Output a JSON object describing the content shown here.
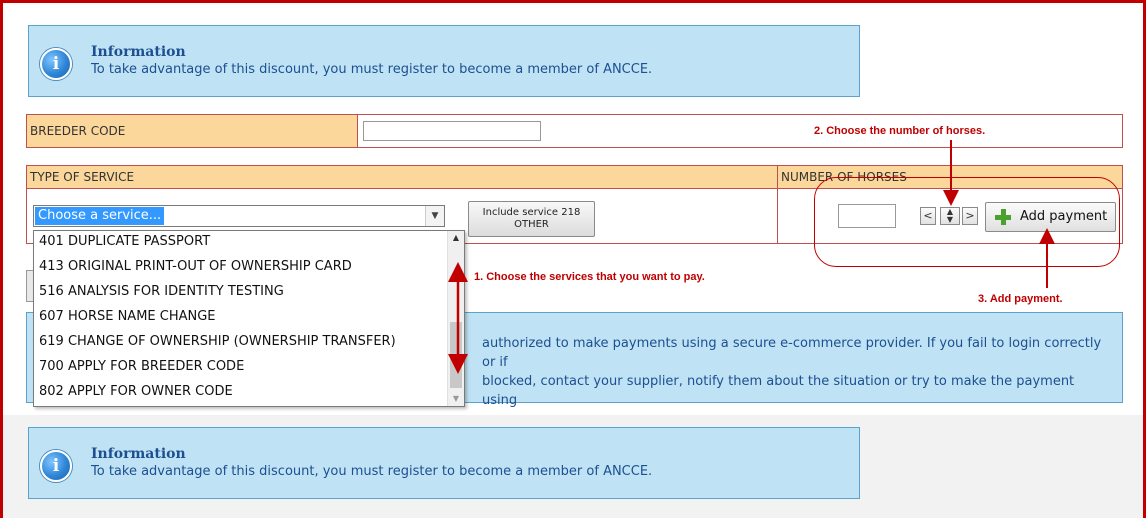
{
  "info_top": {
    "title": "Information",
    "text": "To take advantage of this discount, you must register to become a member of ANCCE."
  },
  "breeder": {
    "label": "BREEDER CODE",
    "value": ""
  },
  "service_table": {
    "type_header": "TYPE OF SERVICE",
    "number_header": "NUMBER OF HORSES",
    "select_value": "Choose a service...",
    "include_button": {
      "line1": "Include service 218",
      "line2": "OTHER"
    },
    "add_button": "Add payment"
  },
  "dropdown_options": [
    "401 DUPLICATE PASSPORT",
    "413 ORIGINAL PRINT-OUT OF OWNERSHIP CARD",
    "516 ANALYSIS FOR IDENTITY TESTING",
    "607 HORSE NAME CHANGE",
    "619 CHANGE OF OWNERSHIP (OWNERSHIP TRANSFER)",
    "700 APPLY FOR BREEDER CODE",
    "802 APPLY FOR OWNER CODE"
  ],
  "info_middle": {
    "line1": "authorized to make payments using a secure e-commerce provider. If you fail to login correctly or if",
    "line2": "blocked, contact your supplier, notify them about the situation or try to make the payment using"
  },
  "annotations": {
    "step1": "1. Choose the services that you want to pay.",
    "step2": "2. Choose the number of horses.",
    "step3": "3. Add payment."
  },
  "info_bottom": {
    "title": "Information",
    "text": "To take advantage of this discount, you must register to become a member of ANCCE."
  },
  "colors": {
    "annotation_red": "#c00000",
    "info_bg": "#bfe3f4",
    "header_bg": "#fbd79b",
    "selection_blue": "#3399ff"
  }
}
